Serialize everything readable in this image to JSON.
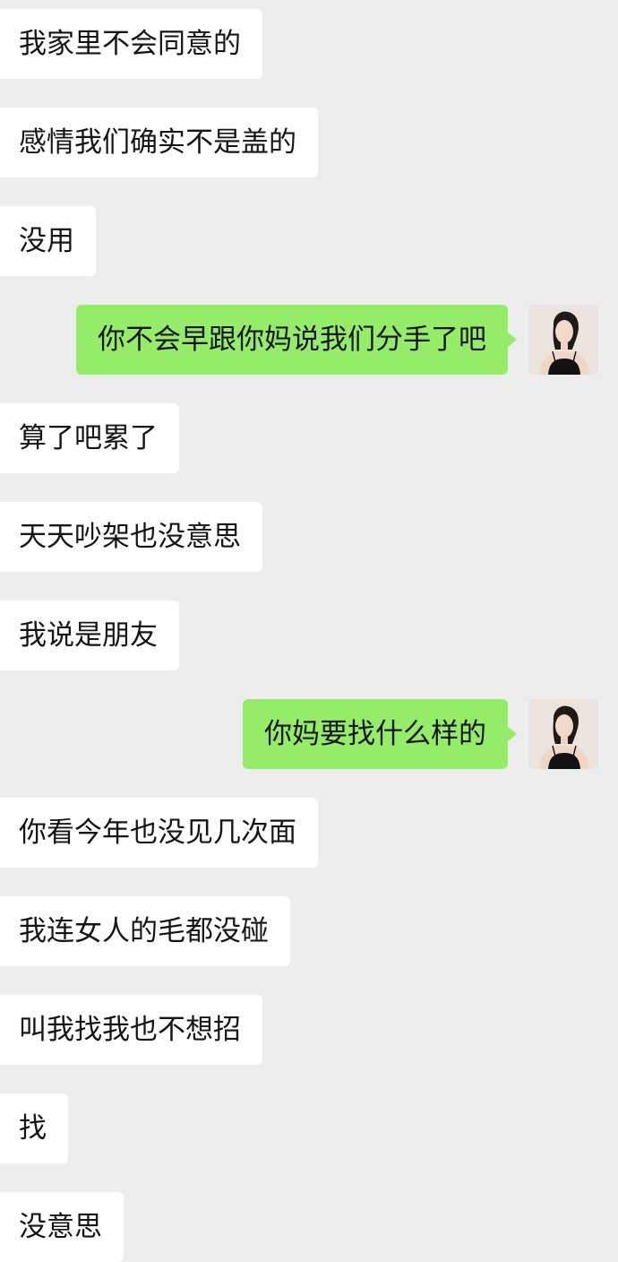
{
  "chat": {
    "messages": [
      {
        "side": "in",
        "text": "我家里不会同意的"
      },
      {
        "side": "in",
        "text": "感情我们确实不是盖的"
      },
      {
        "side": "in",
        "text": "没用"
      },
      {
        "side": "out",
        "text": "你不会早跟你妈说我们分手了吧",
        "avatar": "user-avatar-photo"
      },
      {
        "side": "in",
        "text": "算了吧累了"
      },
      {
        "side": "in",
        "text": "天天吵架也没意思"
      },
      {
        "side": "in",
        "text": "我说是朋友"
      },
      {
        "side": "out",
        "text": "你妈要找什么样的",
        "avatar": "user-avatar-photo"
      },
      {
        "side": "in",
        "text": "你看今年也没见几次面"
      },
      {
        "side": "in",
        "text": "我连女人的毛都没碰"
      },
      {
        "side": "in",
        "text": "叫我找我也不想招"
      },
      {
        "side": "in",
        "text": "找"
      },
      {
        "side": "in",
        "text": "没意思"
      }
    ]
  },
  "colors": {
    "background": "#ededed",
    "incoming_bubble": "#ffffff",
    "outgoing_bubble": "#95ec69",
    "text": "#151515"
  }
}
